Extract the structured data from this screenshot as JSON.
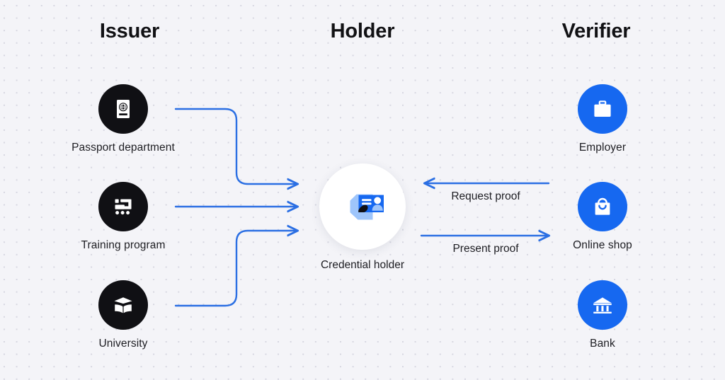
{
  "columns": {
    "issuer": "Issuer",
    "holder": "Holder",
    "verifier": "Verifier"
  },
  "issuers": [
    {
      "label": "Passport department",
      "icon": "passport-icon"
    },
    {
      "label": "Training program",
      "icon": "training-chip-icon"
    },
    {
      "label": "University",
      "icon": "graduation-book-icon"
    }
  ],
  "holder": {
    "label": "Credential holder",
    "icon": "hand-holding-id-card-icon"
  },
  "verifiers": [
    {
      "label": "Employer",
      "icon": "briefcase-icon"
    },
    {
      "label": "Online shop",
      "icon": "shopping-bag-icon"
    },
    {
      "label": "Bank",
      "icon": "bank-building-icon"
    }
  ],
  "flows": [
    {
      "label": "Request proof",
      "direction": "verifier-to-holder"
    },
    {
      "label": "Present proof",
      "direction": "holder-to-verifier"
    }
  ],
  "colors": {
    "accent_blue": "#1668f0",
    "connector_blue": "#2b6fe3",
    "dark_circle": "#101014",
    "card_blue": "#1668f0",
    "hand_blue": "#9ec5fb",
    "background": "#f4f4f8",
    "dot_grid": "#d6d6e0",
    "text": "#1d1d22"
  }
}
